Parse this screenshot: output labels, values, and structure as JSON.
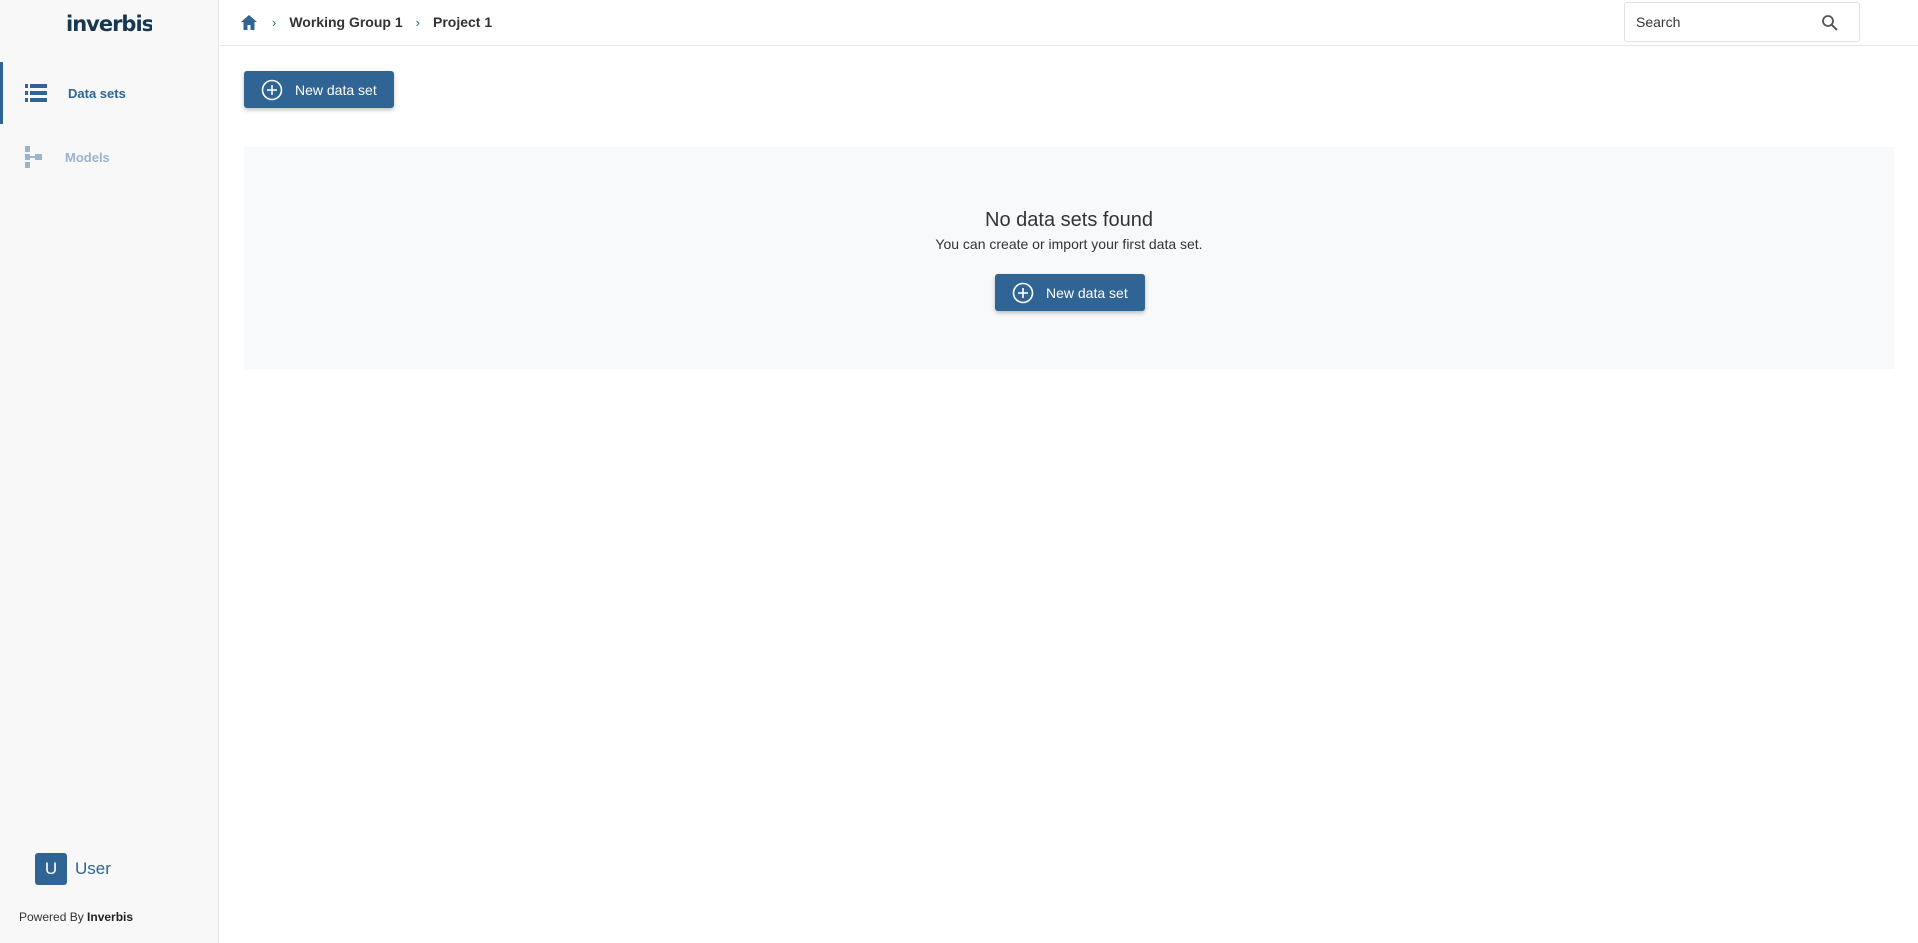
{
  "brand": {
    "logo_text": "inverbis.",
    "accent": "#2f6494"
  },
  "sidebar": {
    "items": [
      {
        "label": "Data sets",
        "icon": "list-icon",
        "active": true
      },
      {
        "label": "Models",
        "icon": "tree-icon",
        "active": false
      }
    ],
    "user": {
      "initial": "U",
      "name": "User"
    },
    "powered_prefix": "Powered By",
    "powered_brand": "Inverbis"
  },
  "breadcrumb": {
    "items": [
      "Working Group 1",
      "Project 1"
    ]
  },
  "search": {
    "placeholder": "Search"
  },
  "toolbar": {
    "new_label": "New data set"
  },
  "empty_state": {
    "title": "No data sets found",
    "subtitle": "You can create or import your first data set.",
    "button_label": "New data set"
  }
}
